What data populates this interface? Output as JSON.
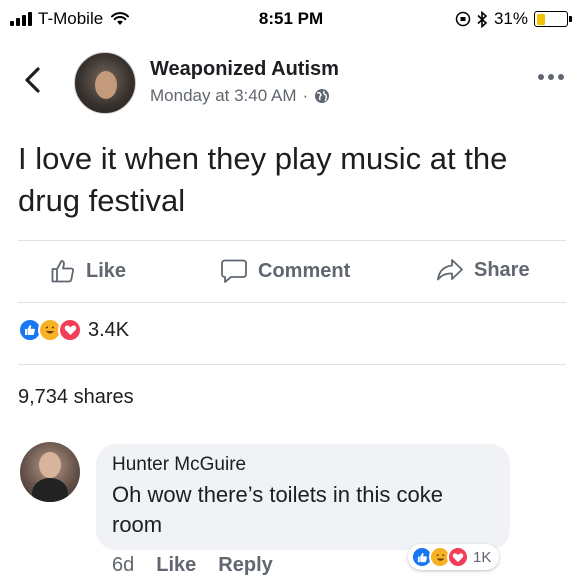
{
  "status_bar": {
    "carrier": "T-Mobile",
    "time": "8:51 PM",
    "battery": "31%",
    "battery_level": 0.31
  },
  "post": {
    "page_name": "Weaponized Autism",
    "timestamp": "Monday at 3:40 AM",
    "meta_separator": "·",
    "text": "I love it when they play music at the drug festival",
    "actions": {
      "like": "Like",
      "comment": "Comment",
      "share": "Share"
    },
    "reaction_count": "3.4K",
    "shares": "9,734 shares"
  },
  "comment": {
    "author": "Hunter McGuire",
    "text": "Oh wow there’s toilets in this coke room",
    "age": "6d",
    "like_label": "Like",
    "reply_label": "Reply",
    "reaction_count": "1K"
  },
  "colors": {
    "like_blue": "#1877f2",
    "haha_yellow": "#f7b125",
    "love_red": "#f33e58",
    "secondary_text": "#606770"
  },
  "icons": {
    "back": "chevron-left-icon",
    "more": "more-horizontal-icon",
    "privacy": "globe-icon",
    "like": "thumbs-up-icon",
    "comment": "speech-bubble-icon",
    "share": "share-arrow-icon"
  }
}
